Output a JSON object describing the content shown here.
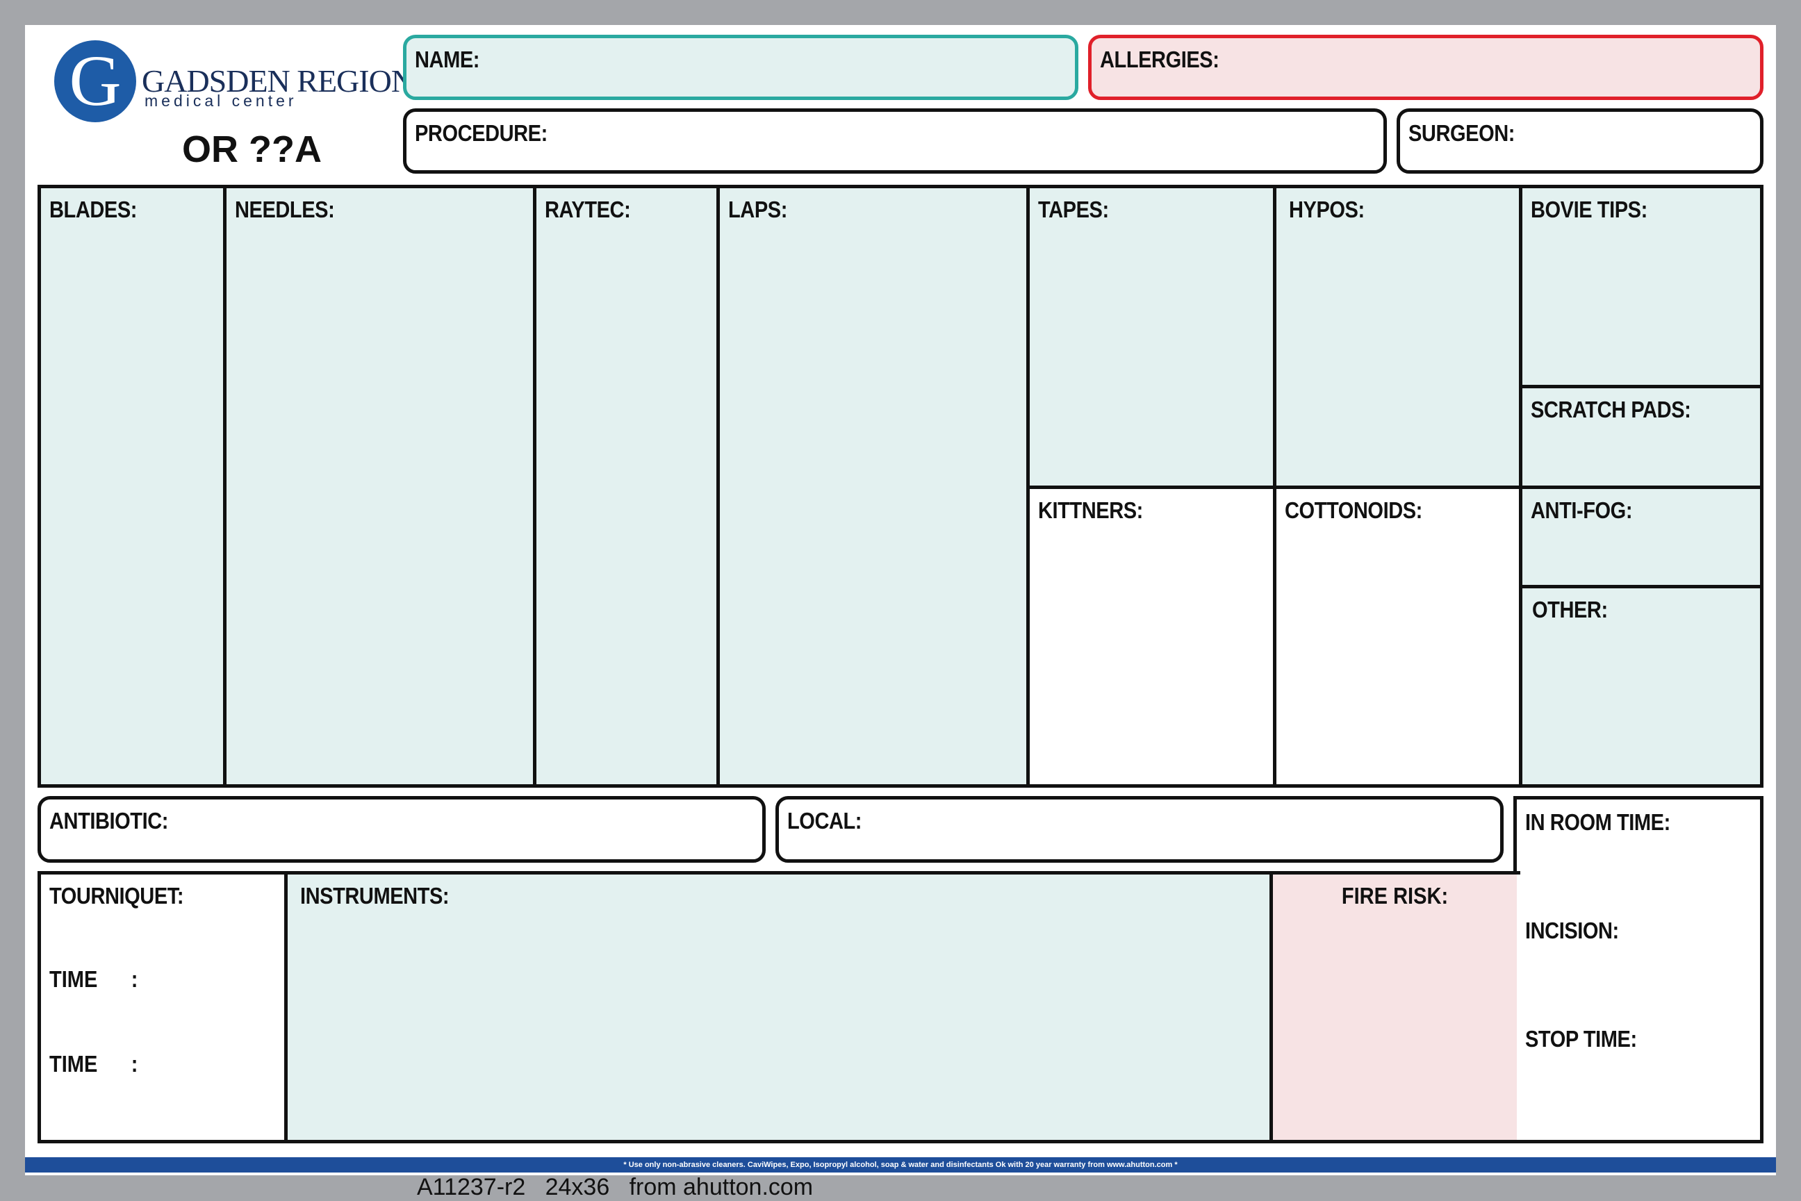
{
  "logo": {
    "name": "GADSDEN REGIONAL",
    "sub": "medical center",
    "letter": "G"
  },
  "room": "OR ??A",
  "header": {
    "name": "NAME:",
    "allergies": "ALLERGIES:",
    "procedure": "PROCEDURE:",
    "surgeon": "SURGEON:"
  },
  "counts": {
    "blades": "BLADES:",
    "needles": "NEEDLES:",
    "raytec": "RAYTEC:",
    "laps": "LAPS:",
    "tapes": "TAPES:",
    "hypos": "HYPOS:",
    "bovie_tips": "BOVIE TIPS:",
    "scratch_pads": "SCRATCH PADS:",
    "kittners": "KITTNERS:",
    "cottonoids": "COTTONOIDS:",
    "anti_fog": "ANTI-FOG:",
    "other": "OTHER:"
  },
  "meds": {
    "antibiotic": "ANTIBIOTIC:",
    "local": "LOCAL:"
  },
  "times": {
    "in_room": "IN ROOM TIME:",
    "incision": "INCISION:",
    "stop": "STOP TIME:"
  },
  "lower": {
    "tourniquet": "TOURNIQUET:",
    "time1": "TIME      :",
    "time2": "TIME      :",
    "instruments": "INSTRUMENTS:",
    "fire_risk": "FIRE RISK:"
  },
  "footer": {
    "note": "* Use only non-abrasive cleaners. CaviWipes, Expo, Isopropyl alcohol, soap & water and disinfectants Ok with 20 year warranty from www.ahutton.com *",
    "code": "A11237-r2   24x36   from ahutton.com"
  },
  "colors": {
    "brand_blue": "#1e5ca7",
    "name_border": "#2aa9a0",
    "allergies_border": "#e0202a",
    "mint_fill": "#e3f1f0",
    "pink_fill": "#f7e3e4"
  }
}
